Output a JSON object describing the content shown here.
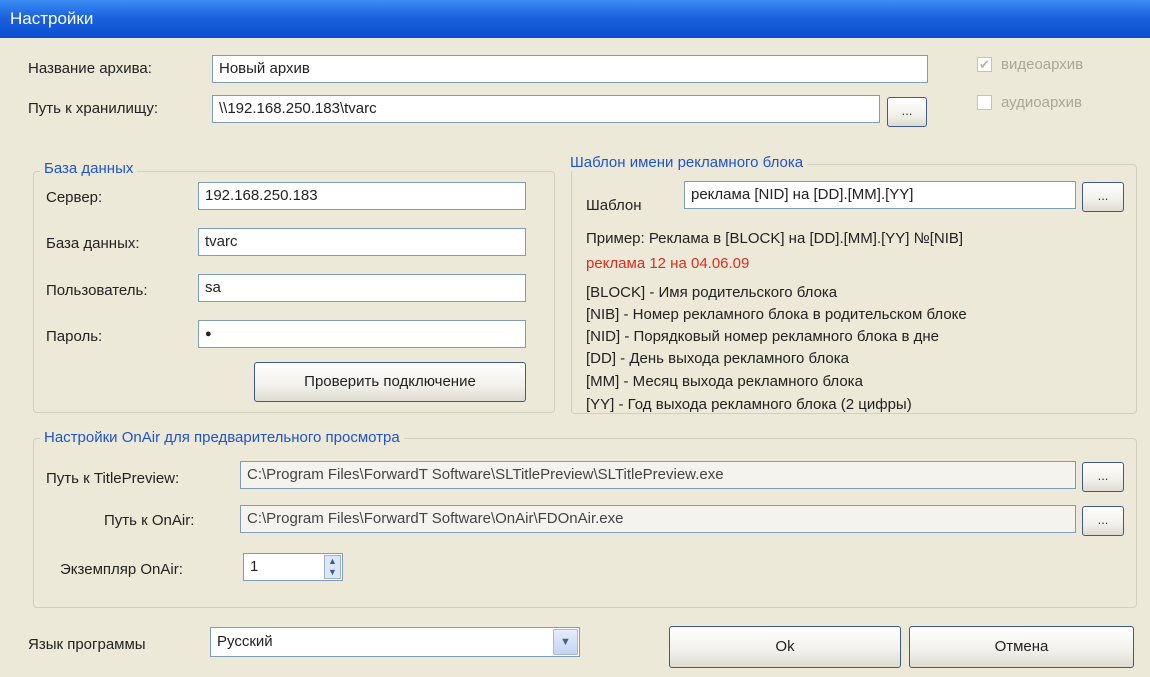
{
  "window": {
    "title": "Настройки"
  },
  "archive": {
    "name_label": "Название архива:",
    "name_value": "Новый архив",
    "path_label": "Путь к хранилищу:",
    "path_value": "\\\\192.168.250.183\\tvarc",
    "browse_label": "...",
    "video_label": "видеоархив",
    "video_checked": true,
    "audio_label": "аудиоархив",
    "audio_checked": false
  },
  "database": {
    "legend": "База данных",
    "server_label": "Сервер:",
    "server_value": "192.168.250.183",
    "db_label": "База данных:",
    "db_value": "tvarc",
    "user_label": "Пользователь:",
    "user_value": "sa",
    "password_label": "Пароль:",
    "password_value": "●",
    "check_button": "Проверить подключение"
  },
  "template": {
    "legend": "Шаблон имени рекламного блока",
    "template_label": "Шаблон",
    "template_value": "реклама [NID] на [DD].[MM].[YY]",
    "browse_label": "...",
    "example": "Пример: Реклама в [BLOCK] на [DD].[MM].[YY] №[NIB]",
    "preview": "реклама 12 на 04.06.09",
    "legend_items": [
      "[BLOCK] - Имя родительского блока",
      "[NIB] - Номер рекламного блока в родительском блоке",
      "[NID] - Порядковый номер рекламного блока в дне",
      "[DD] - День выхода рекламного блока",
      "[MM] - Месяц выхода рекламного блока",
      "[YY] - Год выхода рекламного блока (2 цифры)"
    ]
  },
  "onair": {
    "legend": "Настройки OnAir для предварительного просмотра",
    "title_preview_label": "Путь к TitlePreview:",
    "title_preview_value": "C:\\Program Files\\ForwardT Software\\SLTitlePreview\\SLTitlePreview.exe",
    "onair_label": "Путь к OnAir:",
    "onair_value": "C:\\Program Files\\ForwardT Software\\OnAir\\FDOnAir.exe",
    "browse_label": "...",
    "instance_label": "Экземпляр OnAir:",
    "instance_value": "1"
  },
  "footer": {
    "language_label": "Язык программы",
    "language_value": "Русский",
    "ok_label": "Ok",
    "cancel_label": "Отмена"
  }
}
